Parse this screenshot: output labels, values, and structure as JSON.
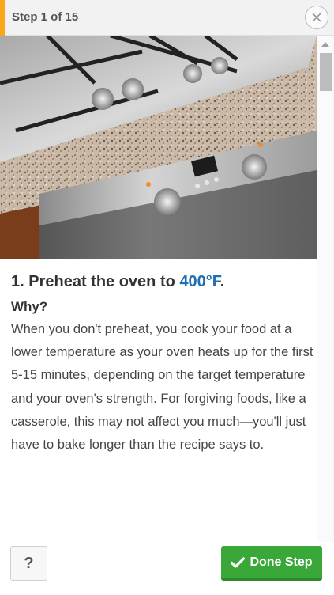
{
  "header": {
    "step_counter": "Step 1 of 15"
  },
  "step": {
    "title_prefix": "1. Preheat the oven to ",
    "title_highlight": "400°F",
    "title_suffix": ".",
    "why_label": "Why?",
    "body": "When you don't preheat, you cook your food at a lower temperature as your oven heats up for the first 5-15 minutes, depending on the target temperature and your oven's strength. For forgiving foods, like a casserole, this may not affect you much—you'll just have to bake longer than the recipe says to."
  },
  "footer": {
    "help_label": "?",
    "done_label": "Done Step"
  },
  "colors": {
    "accent": "#f7a81b",
    "highlight": "#1f6fb2",
    "done": "#3aa739"
  },
  "icons": {
    "close": "close-icon",
    "check": "checkmark-icon"
  }
}
